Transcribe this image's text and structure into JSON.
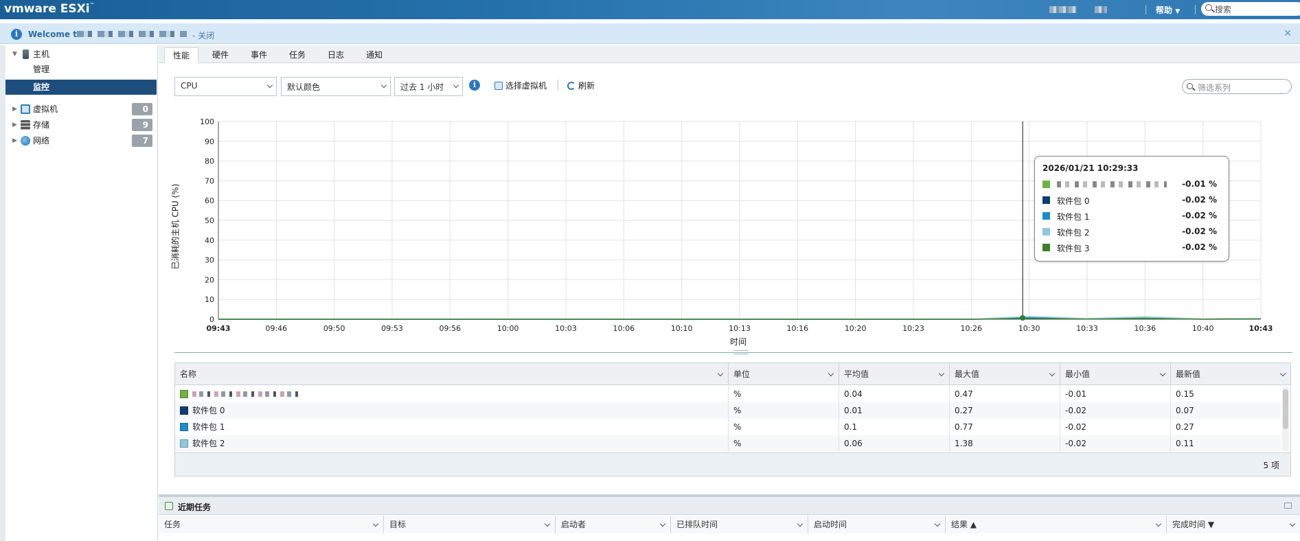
{
  "header": {
    "logo": "vmware ESXi",
    "help_label": "帮助",
    "search_placeholder": "搜索"
  },
  "banner": {
    "welcome": "Welcome to",
    "close_label": "- 关闭"
  },
  "sidebar": {
    "host_label": "主机",
    "manage_label": "管理",
    "monitor_label": "监控",
    "vms_label": "虚拟机",
    "vms_count": "0",
    "storage_label": "存储",
    "storage_count": "9",
    "network_label": "网络",
    "network_count": "7"
  },
  "tabs": [
    "性能",
    "硬件",
    "事件",
    "任务",
    "日志",
    "通知"
  ],
  "toolbar": {
    "metric": "CPU",
    "color_scheme": "默认颜色",
    "time_range": "过去 1 小时",
    "select_vm": "选择虚拟机",
    "refresh": "刷新",
    "filter_placeholder": "筛选系列"
  },
  "chart_data": {
    "type": "line",
    "ylabel": "已消耗的主机 CPU (%)",
    "xlabel": "时间",
    "ylim": [
      0,
      100
    ],
    "yticks": [
      "0",
      "10",
      "20",
      "30",
      "40",
      "50",
      "60",
      "70",
      "80",
      "90",
      "100"
    ],
    "xticks": [
      "09:43",
      "09:46",
      "09:50",
      "09:53",
      "09:56",
      "10:00",
      "10:03",
      "10:06",
      "10:10",
      "10:13",
      "10:16",
      "10:20",
      "10:23",
      "10:26",
      "10:30",
      "10:33",
      "10:36",
      "10:40",
      "10:43"
    ],
    "cursor_time": "10:29:33",
    "series": [
      {
        "name": "",
        "color": "#6fb43f",
        "values": [
          0,
          0,
          0,
          0,
          0,
          0,
          0,
          0,
          0,
          0,
          0,
          0,
          0,
          0,
          0.5,
          0.2,
          0.6,
          0.1,
          0.15
        ]
      },
      {
        "name": "软件包 0",
        "color": "#0d3d75",
        "values": [
          0,
          0,
          0,
          0,
          0,
          0,
          0,
          0,
          0,
          0,
          0,
          0,
          0,
          0,
          0.3,
          0.1,
          0.2,
          0.05,
          0.07
        ]
      },
      {
        "name": "软件包 1",
        "color": "#1d8ccd",
        "values": [
          0,
          0,
          0,
          0,
          0,
          0,
          0,
          0,
          0,
          0,
          0,
          0,
          0,
          0,
          0.8,
          0.2,
          0.4,
          0.1,
          0.27
        ]
      },
      {
        "name": "软件包 2",
        "color": "#8ec9df",
        "values": [
          0,
          0,
          0,
          0,
          0,
          0,
          0,
          0,
          0,
          0,
          0,
          0,
          0,
          0,
          1.4,
          0.3,
          1.2,
          0.1,
          0.11
        ]
      },
      {
        "name": "软件包 3",
        "color": "#3e7e2e",
        "values": [
          0,
          0,
          0,
          0,
          0,
          0,
          0,
          0,
          0,
          0,
          0,
          0,
          0,
          0,
          0.4,
          0.1,
          0.3,
          0.05,
          0.1
        ]
      }
    ]
  },
  "tooltip": {
    "title": "2026/01/21 10:29:33",
    "rows": [
      {
        "name": "",
        "value": "-0.01 %",
        "color": "#6fb43f"
      },
      {
        "name": "软件包 0",
        "value": "-0.02 %",
        "color": "#0d3d75"
      },
      {
        "name": "软件包 1",
        "value": "-0.02 %",
        "color": "#1d8ccd"
      },
      {
        "name": "软件包 2",
        "value": "-0.02 %",
        "color": "#8ec9df"
      },
      {
        "name": "软件包 3",
        "value": "-0.02 %",
        "color": "#3e7e2e"
      }
    ]
  },
  "grid": {
    "columns": [
      "名称",
      "单位",
      "平均值",
      "最大值",
      "最小值",
      "最新值"
    ],
    "rows": [
      {
        "name": "",
        "unit": "%",
        "avg": "0.04",
        "max": "0.47",
        "min": "-0.01",
        "latest": "0.15",
        "color": "#6fb43f"
      },
      {
        "name": "软件包 0",
        "unit": "%",
        "avg": "0.01",
        "max": "0.27",
        "min": "-0.02",
        "latest": "0.07",
        "color": "#0d3d75"
      },
      {
        "name": "软件包 1",
        "unit": "%",
        "avg": "0.1",
        "max": "0.77",
        "min": "-0.02",
        "latest": "0.27",
        "color": "#1d8ccd"
      },
      {
        "name": "软件包 2",
        "unit": "%",
        "avg": "0.06",
        "max": "1.38",
        "min": "-0.02",
        "latest": "0.11",
        "color": "#8ec9df"
      }
    ],
    "count": "5 项"
  },
  "tasks": {
    "title": "近期任务",
    "columns": [
      "任务",
      "目标",
      "启动者",
      "已排队时间",
      "启动时间",
      "结果 ▲",
      "完成时间 ▼"
    ]
  }
}
